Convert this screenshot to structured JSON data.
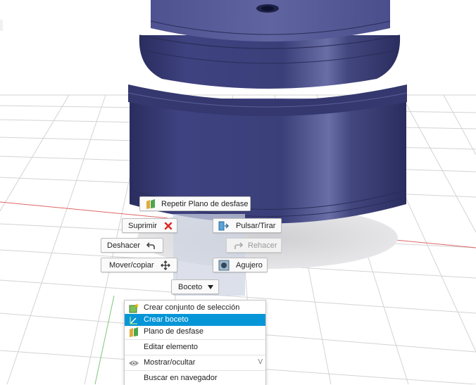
{
  "marking_menu": {
    "repeat": "Repetir Plano de desfase",
    "delete": "Suprimir",
    "press_pull": "Pulsar/Tirar",
    "undo": "Deshacer",
    "redo": "Rehacer",
    "move_copy": "Mover/copiar",
    "hole": "Agujero",
    "sketch_dropdown": "Boceto"
  },
  "context_menu": {
    "items": [
      {
        "label": "Crear conjunto de selección",
        "icon": "selection-set-icon",
        "selected": false
      },
      {
        "label": "Crear boceto",
        "icon": "sketch-icon",
        "selected": true
      },
      {
        "label": "Plano de desfase",
        "icon": "offset-plane-icon",
        "selected": false
      },
      {
        "label": "Editar elemento",
        "icon": "",
        "selected": false
      },
      {
        "label": "Mostrar/ocultar",
        "icon": "eye-icon",
        "selected": false,
        "shortcut": "V"
      },
      {
        "label": "Buscar en navegador",
        "icon": "",
        "selected": false
      }
    ]
  },
  "colors": {
    "selection_blue": "#0696d7",
    "body_color": "#3b3f79",
    "grid_red_axis": "#e06565",
    "grid_green_axis": "#7cc77c"
  }
}
